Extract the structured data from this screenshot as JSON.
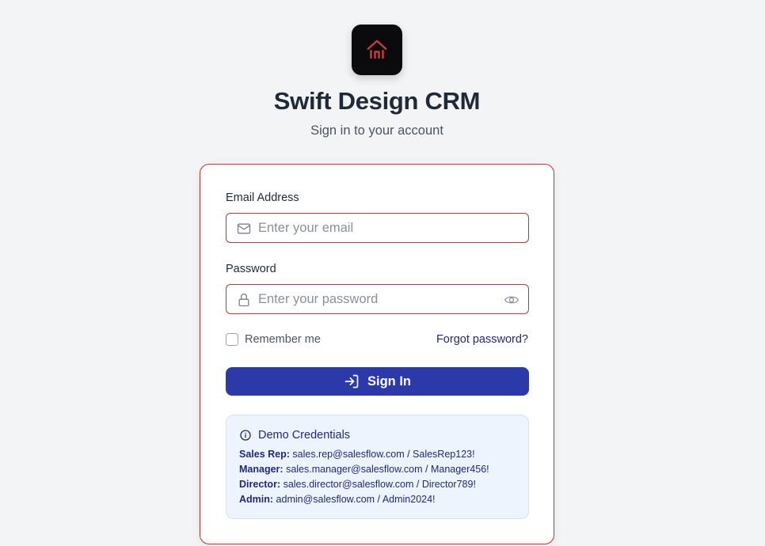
{
  "app": {
    "name": "Swift Design CRM",
    "subtitle": "Sign in to your account",
    "logo_icon": "home-arrow-icon",
    "logo_accent": "#c53a3f"
  },
  "form": {
    "email": {
      "label": "Email Address",
      "placeholder": "Enter your email",
      "value": "",
      "icon": "mail-icon"
    },
    "password": {
      "label": "Password",
      "placeholder": "Enter your password",
      "value": "",
      "icon": "lock-icon",
      "toggle_icon": "eye-icon"
    },
    "remember_label": "Remember me",
    "remember_checked": false,
    "forgot_label": "Forgot password?",
    "submit_label": "Sign In",
    "submit_icon": "login-icon"
  },
  "demo": {
    "title": "Demo Credentials",
    "icon": "info-icon",
    "items": [
      {
        "role": "Sales Rep:",
        "credential": "sales.rep@salesflow.com / SalesRep123!"
      },
      {
        "role": "Manager:",
        "credential": "sales.manager@salesflow.com / Manager456!"
      },
      {
        "role": "Director:",
        "credential": "sales.director@salesflow.com / Director789!"
      },
      {
        "role": "Admin:",
        "credential": "admin@salesflow.com / Admin2024!"
      }
    ]
  },
  "colors": {
    "primary": "#2b3aa8",
    "error_border": "#b33b3b",
    "link": "#1e2a78",
    "background": "#f3f4f6"
  }
}
